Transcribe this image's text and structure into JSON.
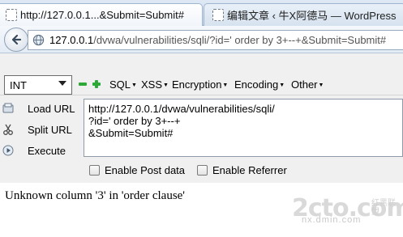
{
  "tabs": [
    {
      "title": "http://127.0.0.1...&Submit=Submit#",
      "active": true
    },
    {
      "title": "编辑文章 ‹ 牛X阿德马 — WordPress",
      "active": false
    }
  ],
  "url": {
    "host": "127.0.0.1",
    "path": "/dvwa/vulnerabilities/sqli/?id=' order by 3+--+&Submit=Submit#"
  },
  "hackbar": {
    "encoding_select": "INT",
    "menus": [
      "SQL",
      "XSS",
      "Encryption",
      "Encoding",
      "Other"
    ],
    "actions": [
      "Load URL",
      "Split URL",
      "Execute"
    ],
    "textarea": "http://127.0.0.1/dvwa/vulnerabilities/sqli/\n?id=' order by 3+--+\n&Submit=Submit#",
    "checkboxes": [
      "Enable Post data",
      "Enable Referrer"
    ]
  },
  "page": {
    "error_text": "Unknown column '3' in 'order clause'"
  },
  "watermark": {
    "logo": "2cto.com",
    "domain": "nx.dmin.com",
    "cn_text": "红黑联盟"
  },
  "colors": {
    "tab_active_bg": "#ffffff",
    "toolbar_bg": "#e3ebf5",
    "hackbar_bg": "#f0f0f0",
    "plus_icon": "#2ea836"
  }
}
